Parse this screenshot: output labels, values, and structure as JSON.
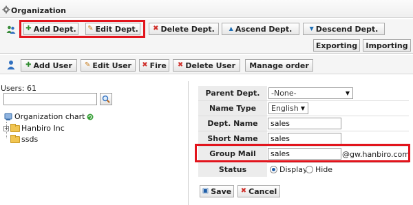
{
  "window": {
    "title": "Organization",
    "icon": "gear-icon"
  },
  "dept_toolbar": {
    "icon": "users-group-icon",
    "buttons": [
      {
        "label": "Add Dept.",
        "icon": "plus-icon"
      },
      {
        "label": "Edit Dept.",
        "icon": "pencil-icon"
      },
      {
        "label": "Delete Dept.",
        "icon": "x-icon"
      },
      {
        "label": "Ascend Dept.",
        "icon": "arrow-up-icon"
      },
      {
        "label": "Descend Dept.",
        "icon": "arrow-down-icon"
      },
      {
        "label": "Exporting"
      },
      {
        "label": "Importing"
      }
    ]
  },
  "user_toolbar": {
    "icon": "user-icon",
    "buttons": [
      {
        "label": "Add User",
        "icon": "plus-icon"
      },
      {
        "label": "Edit User",
        "icon": "pencil-icon"
      },
      {
        "label": "Fire",
        "icon": "x-icon"
      },
      {
        "label": "Delete User",
        "icon": "x-icon"
      },
      {
        "label": "Manage order"
      }
    ]
  },
  "left": {
    "users_count": "Users: 61",
    "search": {
      "value": "",
      "icon": "magnifier-icon"
    },
    "tree": {
      "root": {
        "label": "Organization chart",
        "icon": "org-chart-icon",
        "refresh_icon": "refresh-icon"
      },
      "nodes": [
        {
          "label": "Hanbiro Inc",
          "icon": "folder-icon",
          "expander": "+"
        },
        {
          "label": "ssds",
          "icon": "folder-icon"
        }
      ]
    }
  },
  "form": {
    "parent_dept": {
      "label": "Parent Dept.",
      "value": "-None-"
    },
    "name_type": {
      "label": "Name Type",
      "value": "English"
    },
    "dept_name": {
      "label": "Dept. Name",
      "value": "sales"
    },
    "short_name": {
      "label": "Short Name",
      "value": "sales"
    },
    "group_mail": {
      "label": "Group Mail",
      "value": "sales",
      "suffix": "@gw.hanbiro.com"
    },
    "status": {
      "label": "Status",
      "options": [
        "Display",
        "Hide"
      ],
      "selected": "Display"
    },
    "save_label": "Save",
    "cancel_label": "Cancel"
  },
  "highlight_color": "#e2141c"
}
